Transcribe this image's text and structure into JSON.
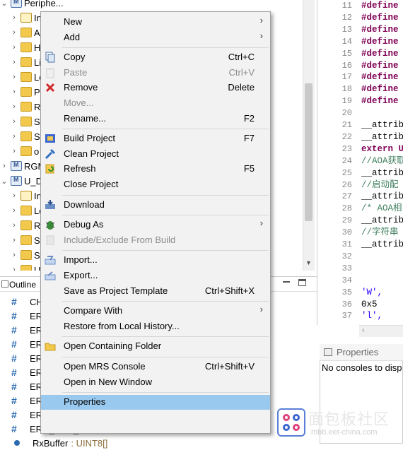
{
  "explorer": {
    "rows": [
      {
        "indent": 1,
        "twisty": "v",
        "icon": "project",
        "label": "Periphe..."
      },
      {
        "indent": 2,
        "twisty": ">",
        "icon": "package",
        "label": "In"
      },
      {
        "indent": 2,
        "twisty": ">",
        "icon": "folder",
        "label": "A"
      },
      {
        "indent": 2,
        "twisty": ">",
        "icon": "folder",
        "label": "H"
      },
      {
        "indent": 2,
        "twisty": ">",
        "icon": "folder",
        "label": "Li"
      },
      {
        "indent": 2,
        "twisty": ">",
        "icon": "folder",
        "label": "Lo"
      },
      {
        "indent": 2,
        "twisty": ">",
        "icon": "folder",
        "label": "P"
      },
      {
        "indent": 2,
        "twisty": ">",
        "icon": "folder",
        "label": "R"
      },
      {
        "indent": 2,
        "twisty": ">",
        "icon": "folder",
        "label": "St"
      },
      {
        "indent": 2,
        "twisty": ">",
        "icon": "folder",
        "label": "St"
      },
      {
        "indent": 2,
        "twisty": ">",
        "icon": "folder",
        "label": "o"
      },
      {
        "indent": 1,
        "twisty": ">",
        "icon": "project",
        "label": "RGM"
      },
      {
        "indent": 1,
        "twisty": "v",
        "icon": "project",
        "label": "U_D"
      },
      {
        "indent": 2,
        "twisty": ">",
        "icon": "package",
        "label": "In"
      },
      {
        "indent": 2,
        "twisty": ">",
        "icon": "folder",
        "label": "Lo"
      },
      {
        "indent": 2,
        "twisty": ">",
        "icon": "folder",
        "label": "R"
      },
      {
        "indent": 2,
        "twisty": ">",
        "icon": "folder",
        "label": "St"
      },
      {
        "indent": 2,
        "twisty": ">",
        "icon": "folder",
        "label": "St"
      },
      {
        "indent": 2,
        "twisty": ">",
        "icon": "folder",
        "label": "U"
      }
    ]
  },
  "outline": {
    "tab_label": "Outline",
    "rows": [
      {
        "icon": "hash",
        "label": "CH"
      },
      {
        "icon": "hash",
        "label": "ERR"
      },
      {
        "icon": "hash",
        "label": "ERR"
      },
      {
        "icon": "hash",
        "label": "ERR"
      },
      {
        "icon": "hash",
        "label": "ERR"
      },
      {
        "icon": "hash",
        "label": "ERR"
      },
      {
        "icon": "hash",
        "label": "ERR"
      },
      {
        "icon": "hash",
        "label": "ERR"
      },
      {
        "icon": "hash",
        "label": "ERR_USB_UNKNOWN"
      },
      {
        "icon": "hash",
        "label": "ERR_AOA_PROTOCOL"
      },
      {
        "icon": "dot",
        "label": "RxBuffer",
        "type": ": UINT8[]"
      }
    ]
  },
  "editor": {
    "lines": [
      {
        "n": "11",
        "text": "#define",
        "cls": "kw"
      },
      {
        "n": "12",
        "text": "#define",
        "cls": "kw"
      },
      {
        "n": "13",
        "text": "#define",
        "cls": "kw"
      },
      {
        "n": "14",
        "text": "#define",
        "cls": "kw"
      },
      {
        "n": "15",
        "text": "#define",
        "cls": "kw"
      },
      {
        "n": "16",
        "text": "#define",
        "cls": "kw"
      },
      {
        "n": "17",
        "text": "#define",
        "cls": "kw"
      },
      {
        "n": "18",
        "text": "#define",
        "cls": "kw"
      },
      {
        "n": "19",
        "text": "#define",
        "cls": "kw"
      },
      {
        "n": "20",
        "text": "",
        "cls": ""
      },
      {
        "n": "21",
        "text": "__attrib",
        "cls": ""
      },
      {
        "n": "22",
        "text": "__attrib",
        "cls": ""
      },
      {
        "n": "23",
        "text": "extern U",
        "cls": "kw"
      },
      {
        "n": "24",
        "text": "//AOA获取",
        "cls": "cm"
      },
      {
        "n": "25",
        "text": "__attrib",
        "cls": ""
      },
      {
        "n": "26",
        "text": "//启动配",
        "cls": "cm"
      },
      {
        "n": "27",
        "text": "__attrib",
        "cls": ""
      },
      {
        "n": "28",
        "text": "/* AOA相",
        "cls": "cm"
      },
      {
        "n": "29",
        "text": "__attrib",
        "cls": ""
      },
      {
        "n": "30",
        "text": "//字符串",
        "cls": "cm"
      },
      {
        "n": "31",
        "text": "__attrib",
        "cls": ""
      },
      {
        "n": "32",
        "text": "",
        "cls": ""
      },
      {
        "n": "33",
        "text": "",
        "cls": ""
      },
      {
        "n": "34",
        "text": "",
        "cls": ""
      },
      {
        "n": "35",
        "text": "   'W',",
        "cls": "str"
      },
      {
        "n": "36",
        "text": "   0x5",
        "cls": ""
      },
      {
        "n": "37",
        "text": "   'l',",
        "cls": "str"
      }
    ]
  },
  "properties": {
    "tab_label": "Properties",
    "message": "No consoles to disp"
  },
  "menu": {
    "items": [
      {
        "type": "item",
        "label": "New",
        "submenu": true,
        "icon": ""
      },
      {
        "type": "item",
        "label": "Add",
        "submenu": true,
        "icon": ""
      },
      {
        "type": "sep"
      },
      {
        "type": "item",
        "label": "Copy",
        "shortcut": "Ctrl+C",
        "icon": "copy"
      },
      {
        "type": "item",
        "label": "Paste",
        "shortcut": "Ctrl+V",
        "disabled": true,
        "icon": "paste"
      },
      {
        "type": "item",
        "label": "Remove",
        "shortcut": "Delete",
        "icon": "remove"
      },
      {
        "type": "item",
        "label": "Move...",
        "disabled": true,
        "icon": ""
      },
      {
        "type": "item",
        "label": "Rename...",
        "shortcut": "F2",
        "icon": ""
      },
      {
        "type": "sep"
      },
      {
        "type": "item",
        "label": "Build Project",
        "shortcut": "F7",
        "icon": "build"
      },
      {
        "type": "item",
        "label": "Clean Project",
        "icon": "clean"
      },
      {
        "type": "item",
        "label": "Refresh",
        "shortcut": "F5",
        "icon": "refresh"
      },
      {
        "type": "item",
        "label": "Close Project",
        "icon": ""
      },
      {
        "type": "sep"
      },
      {
        "type": "item",
        "label": "Download",
        "icon": "download"
      },
      {
        "type": "sep"
      },
      {
        "type": "item",
        "label": "Debug As",
        "submenu": true,
        "icon": "debug"
      },
      {
        "type": "item",
        "label": "Include/Exclude From Build",
        "disabled": true,
        "icon": "include"
      },
      {
        "type": "sep"
      },
      {
        "type": "item",
        "label": "Import...",
        "icon": "import"
      },
      {
        "type": "item",
        "label": "Export...",
        "icon": "export"
      },
      {
        "type": "item",
        "label": "Save as Project Template",
        "shortcut": "Ctrl+Shift+X",
        "icon": ""
      },
      {
        "type": "sep"
      },
      {
        "type": "item",
        "label": "Compare With",
        "submenu": true,
        "icon": ""
      },
      {
        "type": "item",
        "label": "Restore from Local History...",
        "icon": ""
      },
      {
        "type": "sep"
      },
      {
        "type": "item",
        "label": "Open Containing Folder",
        "icon": "folder"
      },
      {
        "type": "sep"
      },
      {
        "type": "item",
        "label": "Open MRS Console",
        "shortcut": "Ctrl+Shift+V",
        "icon": ""
      },
      {
        "type": "item",
        "label": "Open in New Window",
        "icon": ""
      },
      {
        "type": "sep"
      },
      {
        "type": "item",
        "label": "Properties",
        "highlighted": true,
        "icon": ""
      }
    ]
  },
  "watermark": {
    "title": "面包板社区",
    "url": "mbb.eet-china.com"
  }
}
